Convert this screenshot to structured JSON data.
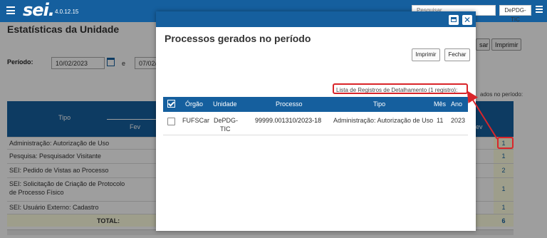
{
  "app": {
    "logo": "sei.",
    "version": "4.0.12.15",
    "search_placeholder": "Pesquisar...",
    "unit": "DePDG-TIC"
  },
  "page": {
    "title": "Estatísticas da Unidade",
    "period_label": "Período:",
    "date_start": "10/02/2023",
    "connector": "e",
    "date_end": "07/02/",
    "btn_search_partial": "sar",
    "btn_print": "Imprimir",
    "note_partial": "ados no período:",
    "table": {
      "header_tipo": "Tipo",
      "header_fev": "Fev",
      "header_fev2": "ev",
      "rows": [
        {
          "label": "Administração: Autorização de Uso",
          "value": "1"
        },
        {
          "label": "Pesquisa: Pesquisador Visitante",
          "value": "1"
        },
        {
          "label": "SEI: Pedido de Vistas ao Processo",
          "value": "2"
        },
        {
          "label_line1": "SEI: Solicitação de Criação de Protocolo",
          "label_line2": "de Processo Físico",
          "value": "1"
        },
        {
          "label": "SEI: Usuário Externo: Cadastro",
          "value": "1"
        }
      ],
      "total_label": "TOTAL:",
      "total_value": "6"
    }
  },
  "modal": {
    "close_glyph": "✕",
    "title": "Processos gerados no período",
    "btn_print": "Imprimir",
    "btn_close": "Fechar",
    "caption": "Lista de Registros de Detalhamento (1 registro):",
    "columns": [
      "Órgão",
      "Unidade",
      "Processo",
      "Tipo",
      "Mês",
      "Ano"
    ],
    "row": {
      "orgao": "FUFSCar",
      "unidade_line1": "DePDG-",
      "unidade_line2": "TIC",
      "processo": "99999.001310/2023-18",
      "tipo": "Administração: Autorização de Uso",
      "mes": "11",
      "ano": "2023"
    }
  },
  "colors": {
    "primary": "#155f9e",
    "annotation": "#d9252a",
    "highlight_cell": "#ffffe0"
  }
}
